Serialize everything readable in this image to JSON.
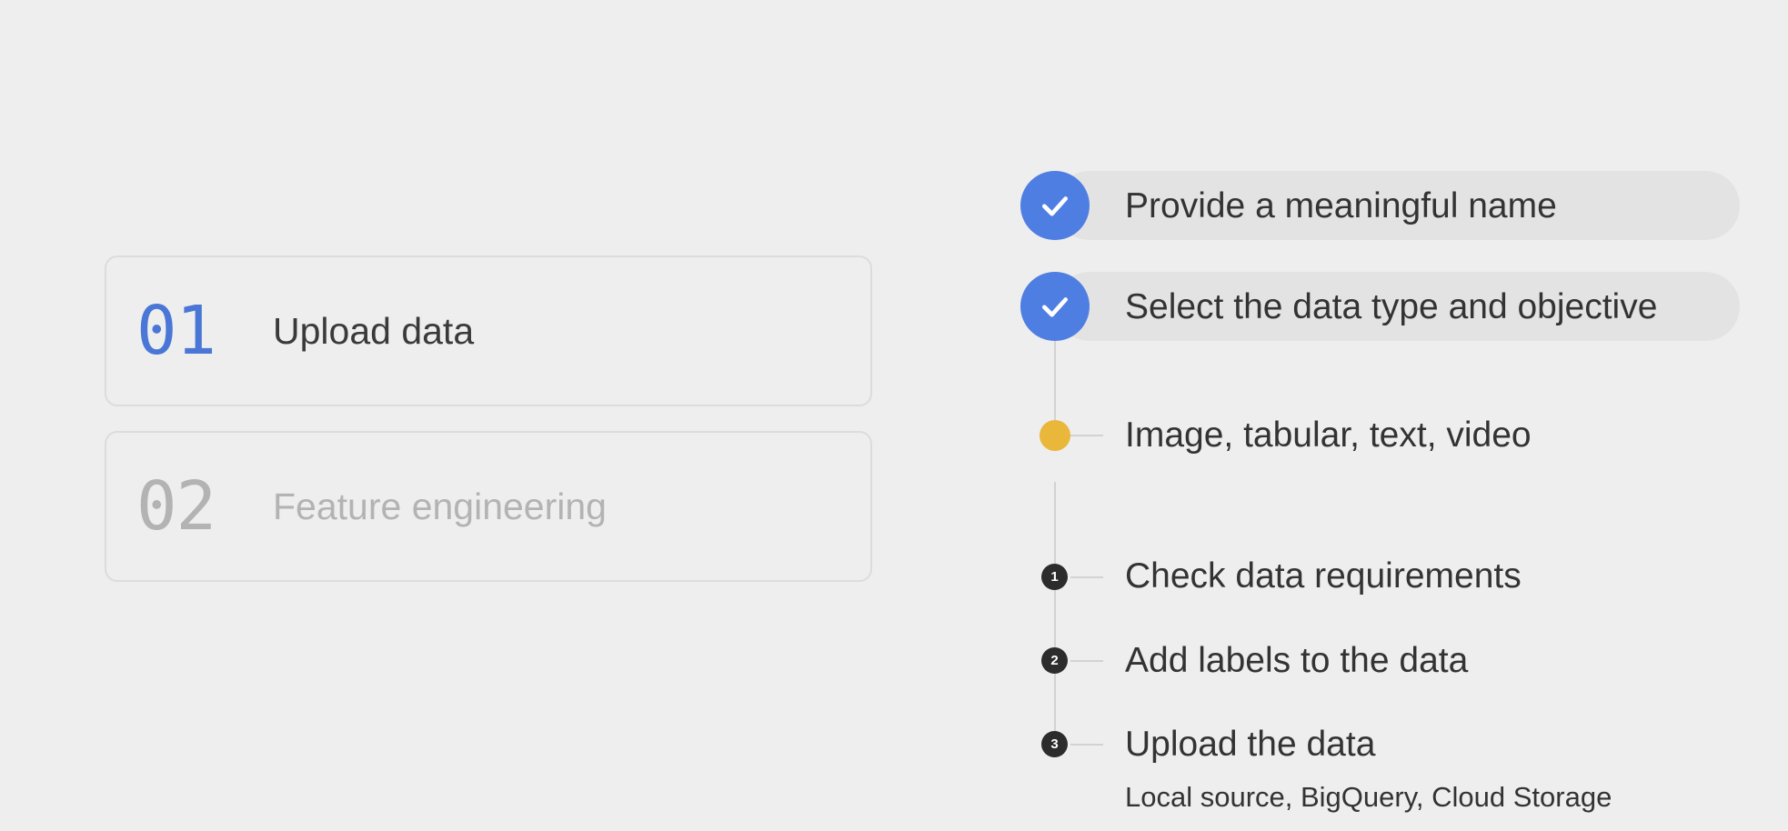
{
  "steps": [
    {
      "number": "01",
      "label": "Upload data",
      "state": "active"
    },
    {
      "number": "02",
      "label": "Feature engineering",
      "state": "inactive"
    }
  ],
  "checklist": {
    "completed": [
      {
        "label": "Provide a meaningful name",
        "icon": "check-icon"
      },
      {
        "label": "Select the data type and objective",
        "icon": "check-icon"
      }
    ],
    "highlight": {
      "label": "Image, tabular, text, video"
    },
    "numbered": [
      {
        "number": "1",
        "label": "Check data requirements"
      },
      {
        "number": "2",
        "label": "Add labels to the data"
      },
      {
        "number": "3",
        "label": "Upload the data",
        "sublabel": "Local source, BigQuery, Cloud Storage"
      }
    ]
  },
  "colors": {
    "background": "#eeeeee",
    "accent_blue": "#4f7ee3",
    "step_active_number": "#4a76d6",
    "highlight_yellow": "#e9b73a",
    "numbered_dot": "#2c2c2c",
    "inactive_text": "#b3b3b3"
  }
}
